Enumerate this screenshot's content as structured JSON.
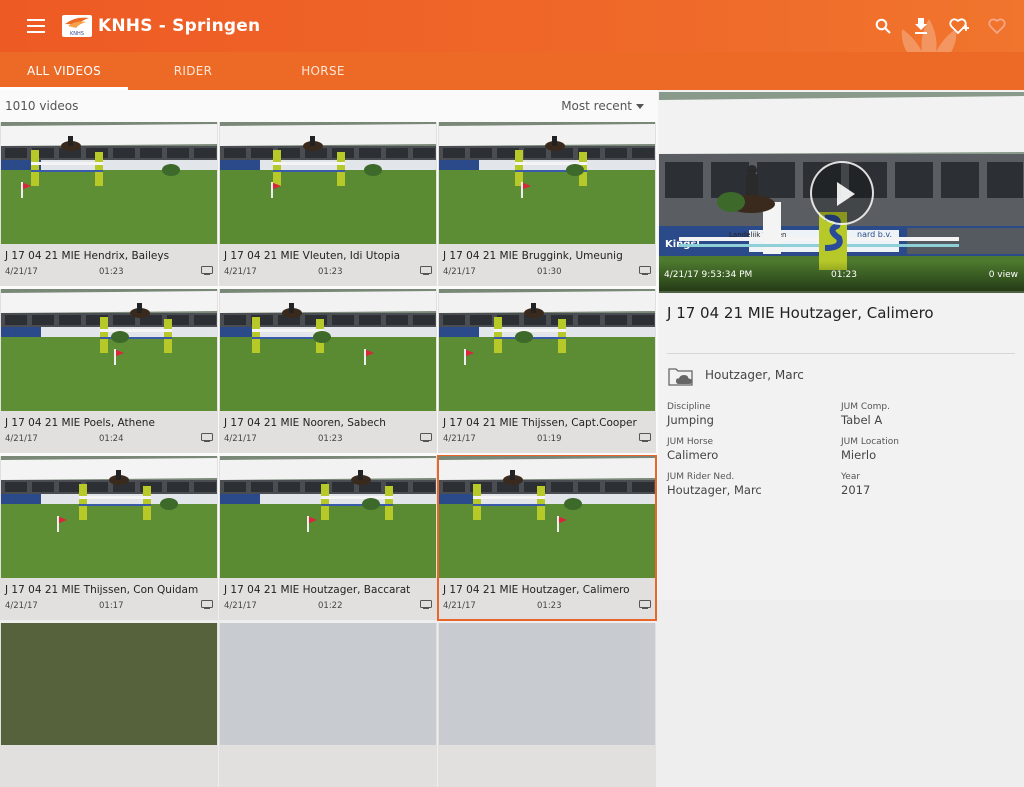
{
  "app": {
    "title": "KNHS - Springen",
    "logo_text": "KNHS"
  },
  "toolbar": {
    "icons": [
      "menu-icon",
      "search-icon",
      "download-icon",
      "favorite-add-icon",
      "favorite-icon"
    ]
  },
  "tabs": [
    {
      "label": "ALL VIDEOS",
      "active": true
    },
    {
      "label": "RIDER",
      "active": false
    },
    {
      "label": "HORSE",
      "active": false
    }
  ],
  "list": {
    "count": "1010 videos",
    "sort_label": "Most recent",
    "videos": [
      {
        "title": "J 17 04 21 MIE Hendrix, Baileys",
        "date": "4/21/17",
        "duration": "01:23"
      },
      {
        "title": "J 17 04 21 MIE Vleuten, Idi Utopia",
        "date": "4/21/17",
        "duration": "01:23"
      },
      {
        "title": "J 17 04 21 MIE Bruggink, Umeunig",
        "date": "4/21/17",
        "duration": "01:30"
      },
      {
        "title": "J 17 04 21 MIE Poels, Athene",
        "date": "4/21/17",
        "duration": "01:24"
      },
      {
        "title": "J 17 04 21 MIE Nooren, Sabech",
        "date": "4/21/17",
        "duration": "01:23"
      },
      {
        "title": "J 17 04 21 MIE Thijssen, Capt.Cooper",
        "date": "4/21/17",
        "duration": "01:19"
      },
      {
        "title": "J 17 04 21 MIE Thijssen, Con Quidam",
        "date": "4/21/17",
        "duration": "01:17"
      },
      {
        "title": "J 17 04 21 MIE Houtzager, Baccarat",
        "date": "4/21/17",
        "duration": "01:22"
      },
      {
        "title": "J 17 04 21 MIE Houtzager, Calimero",
        "date": "4/21/17",
        "duration": "01:23",
        "selected": true
      }
    ]
  },
  "detail": {
    "player": {
      "datetime": "4/21/17 9:53:34 PM",
      "duration": "01:23",
      "views": "0 view",
      "banner_text": "Landelijk Wonen",
      "banner_text2": "Kingsl",
      "banner_text3": "nard b.v."
    },
    "title": "J 17 04 21 MIE Houtzager, Calimero",
    "rider": "Houtzager, Marc",
    "meta": [
      {
        "label": "Discipline",
        "value": "Jumping"
      },
      {
        "label": "JUM Comp.",
        "value": "Tabel A"
      },
      {
        "label": "JUM Horse",
        "value": "Calimero"
      },
      {
        "label": "JUM Location",
        "value": "Mierlo"
      },
      {
        "label": "JUM Rider Ned.",
        "value": "Houtzager, Marc"
      },
      {
        "label": "Year",
        "value": "2017"
      }
    ]
  },
  "colors": {
    "primary": "#ee5a24",
    "tabbar": "#ec6a26",
    "selected_outline": "#e8662a"
  }
}
